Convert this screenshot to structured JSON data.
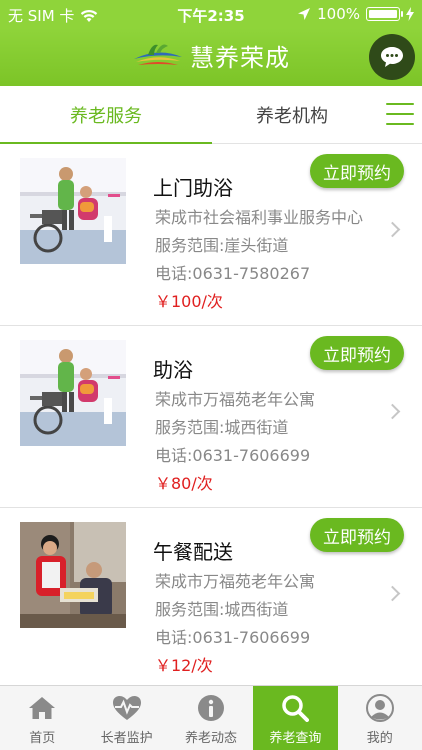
{
  "status_bar": {
    "carrier": "无 SIM 卡",
    "time": "下午2:35",
    "battery": "100%"
  },
  "header": {
    "title": "慧养荣成",
    "chat_icon": "chat-bubble-icon"
  },
  "tabs": [
    {
      "label": "养老服务",
      "active": true
    },
    {
      "label": "养老机构",
      "active": false
    }
  ],
  "services": [
    {
      "name": "上门助浴",
      "org": "荣成市社会福利事业服务中心",
      "range": "服务范围:崖头街道",
      "phone": "电话:0631-7580267",
      "price": "￥100/次",
      "book_label": "立即预约"
    },
    {
      "name": "助浴",
      "org": "荣成市万福苑老年公寓",
      "range": "服务范围:城西街道",
      "phone": "电话:0631-7606699",
      "price": "￥80/次",
      "book_label": "立即预约"
    },
    {
      "name": "午餐配送",
      "org": "荣成市万福苑老年公寓",
      "range": "服务范围:城西街道",
      "phone": "电话:0631-7606699",
      "price": "￥12/次",
      "book_label": "立即预约"
    }
  ],
  "nav": [
    {
      "label": "首页",
      "icon": "home-icon",
      "active": false
    },
    {
      "label": "长者监护",
      "icon": "heart-pulse-icon",
      "active": false
    },
    {
      "label": "养老动态",
      "icon": "info-icon",
      "active": false
    },
    {
      "label": "养老查询",
      "icon": "search-icon",
      "active": true
    },
    {
      "label": "我的",
      "icon": "user-icon",
      "active": false
    }
  ],
  "colors": {
    "brand_green": "#6ab920",
    "header_green": "#8fd43a",
    "price_red": "#e02020"
  }
}
